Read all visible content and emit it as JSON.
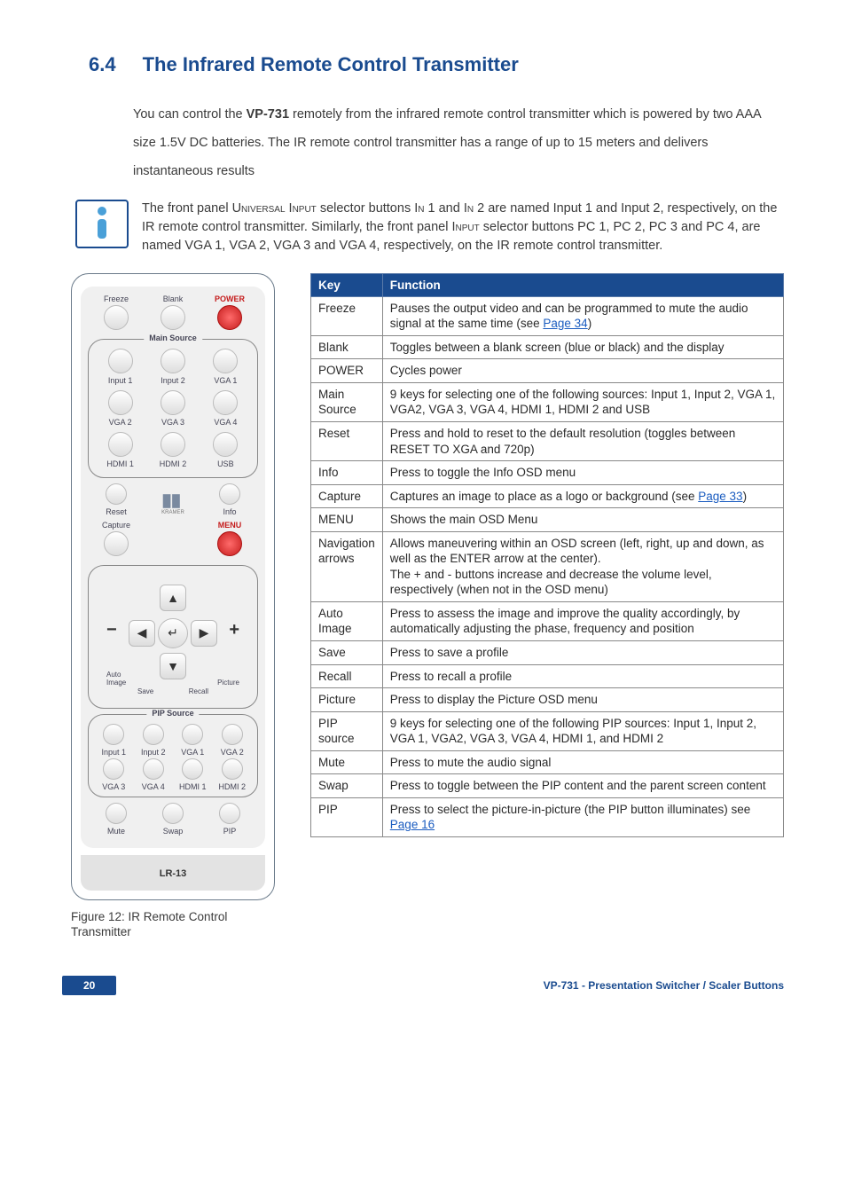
{
  "heading": {
    "number": "6.4",
    "title": "The Infrared Remote Control Transmitter"
  },
  "intro": {
    "prefix": "You can control the ",
    "bold": "VP-731",
    "suffix": " remotely from the infrared remote control transmitter which is powered by two AAA size 1.5V DC batteries. The IR remote control transmitter has a range of up to 15 meters and delivers instantaneous results"
  },
  "note": {
    "p1a": "The front panel ",
    "p1b": "Universal Input",
    "p1c": " selector buttons ",
    "p1d": "In",
    "p1e": " 1 and ",
    "p1f": "In",
    "p1g": " 2 are named Input 1 and Input 2, respectively, on the IR remote control transmitter. Similarly, the front panel ",
    "p1h": "Input",
    "p1i": " selector buttons PC 1, PC 2, PC 3 and PC 4, are named VGA 1, VGA 2, VGA 3 and VGA 4, respectively, on the IR remote control transmitter."
  },
  "remote": {
    "freeze": "Freeze",
    "blank": "Blank",
    "power": "POWER",
    "main_source": "Main Source",
    "input1": "Input 1",
    "input2": "Input 2",
    "vga1": "VGA 1",
    "vga2": "VGA 2",
    "vga3": "VGA 3",
    "vga4": "VGA 4",
    "hdmi1": "HDMI 1",
    "hdmi2": "HDMI 2",
    "usb": "USB",
    "reset": "Reset",
    "info": "Info",
    "capture": "Capture",
    "brand": "KRAMER",
    "menu": "MENU",
    "auto_image": "Auto Image",
    "picture": "Picture",
    "save": "Save",
    "recall": "Recall",
    "pip_source": "PIP Source",
    "p_input1": "Input 1",
    "p_input2": "Input 2",
    "p_vga1": "VGA 1",
    "p_vga2": "VGA 2",
    "p_vga3": "VGA 3",
    "p_vga4": "VGA 4",
    "p_hdmi1": "HDMI 1",
    "p_hdmi2": "HDMI 2",
    "mute": "Mute",
    "swap": "Swap",
    "pip": "PIP",
    "model": "LR-13"
  },
  "caption": "Figure 12: IR Remote Control Transmitter",
  "table": {
    "head_key": "Key",
    "head_fn": "Function",
    "rows": [
      {
        "k": "Freeze",
        "f_pre": "Pauses the output video and can be programmed to mute the audio signal at the same time (see ",
        "f_link": "Page 34",
        "f_post": ")"
      },
      {
        "k": "Blank",
        "f": "Toggles between a blank screen (blue or black) and the display"
      },
      {
        "k": "POWER",
        "f": "Cycles power"
      },
      {
        "k": "Main Source",
        "f": "9 keys for selecting one of the following sources: Input 1, Input 2, VGA 1, VGA2, VGA 3, VGA 4, HDMI 1, HDMI 2 and USB"
      },
      {
        "k": "Reset",
        "f": "Press and hold to reset to the default resolution (toggles between RESET TO XGA and 720p)"
      },
      {
        "k": "Info",
        "f": "Press to toggle the Info OSD menu"
      },
      {
        "k": "Capture",
        "f_pre": "Captures an image to place as a logo or background (see ",
        "f_link": "Page 33",
        "f_post": ")"
      },
      {
        "k": "MENU",
        "f": "Shows the main OSD Menu"
      },
      {
        "k": "Navigation arrows",
        "f": "Allows maneuvering within an OSD screen (left, right, up and down, as well as the ENTER arrow at the center).\nThe + and - buttons increase and decrease the volume level, respectively (when not in the OSD menu)"
      },
      {
        "k": "Auto Image",
        "f": "Press to assess the image and improve the quality accordingly, by automatically adjusting the phase, frequency and position"
      },
      {
        "k": "Save",
        "f": "Press to save a profile"
      },
      {
        "k": "Recall",
        "f": "Press to recall a profile"
      },
      {
        "k": "Picture",
        "f": "Press to display the Picture OSD menu"
      },
      {
        "k": "PIP source",
        "f": "9 keys for selecting one of the following PIP sources: Input 1, Input 2, VGA 1, VGA2, VGA 3, VGA 4, HDMI 1, and HDMI 2"
      },
      {
        "k": "Mute",
        "f": "Press to mute the audio signal"
      },
      {
        "k": "Swap",
        "f": "Press to toggle between the PIP content and the parent screen content"
      },
      {
        "k": "PIP",
        "f_pre": "Press to select the picture-in-picture (the PIP button illuminates) see ",
        "f_link": "Page 16",
        "f_post": ""
      }
    ]
  },
  "footer": {
    "page": "20",
    "right": "VP-731 - Presentation Switcher / Scaler Buttons"
  }
}
